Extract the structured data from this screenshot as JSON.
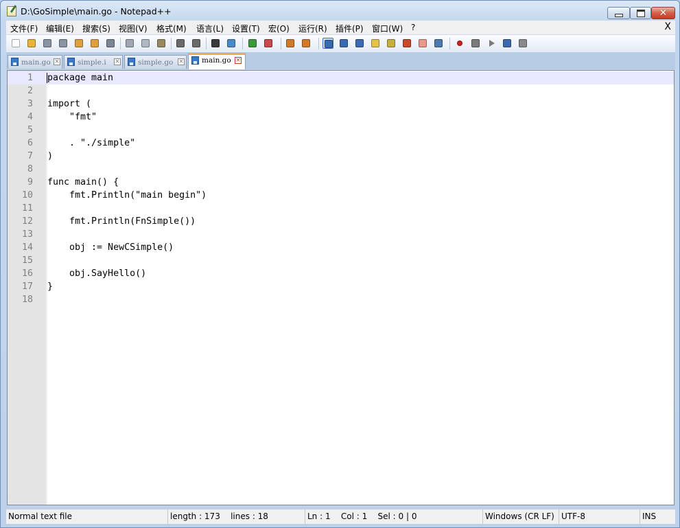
{
  "window": {
    "title": "D:\\GoSimple\\main.go - Notepad++",
    "controls": {
      "minimize": "_",
      "maximize": "□",
      "close": "✕"
    }
  },
  "menu": {
    "items": [
      {
        "label": "文件(F)"
      },
      {
        "label": "编辑(E)"
      },
      {
        "label": "搜索(S)"
      },
      {
        "label": "视图(V)"
      },
      {
        "label": "格式(M)"
      },
      {
        "label": "语言(L)"
      },
      {
        "label": "设置(T)"
      },
      {
        "label": "宏(O)"
      },
      {
        "label": "运行(R)"
      },
      {
        "label": "插件(P)"
      },
      {
        "label": "窗口(W)"
      },
      {
        "label": "?"
      }
    ],
    "close_glyph": "X"
  },
  "toolbar": {
    "buttons": [
      {
        "icon": "new-file-icon",
        "color": "#ffffff"
      },
      {
        "icon": "open-file-icon",
        "color": "#e8b53a"
      },
      {
        "icon": "save-icon",
        "color": "#8a95a3"
      },
      {
        "icon": "save-all-icon",
        "color": "#8a95a3"
      },
      {
        "icon": "close-file-icon",
        "color": "#e0a040"
      },
      {
        "icon": "close-all-icon",
        "color": "#e0a040"
      },
      {
        "icon": "print-icon",
        "color": "#7b8694"
      },
      {
        "icon": "cut-icon",
        "color": "#a0a8b4"
      },
      {
        "icon": "copy-icon",
        "color": "#b0b8c4"
      },
      {
        "icon": "paste-icon",
        "color": "#9a8a60"
      },
      {
        "icon": "undo-icon",
        "color": "#6a6a6a"
      },
      {
        "icon": "redo-icon",
        "color": "#6a6a6a"
      },
      {
        "icon": "find-icon",
        "color": "#3a3a3a"
      },
      {
        "icon": "replace-icon",
        "color": "#4a8ac8"
      },
      {
        "icon": "zoom-in-icon",
        "color": "#3a9a3a"
      },
      {
        "icon": "zoom-out-icon",
        "color": "#c84a4a"
      },
      {
        "icon": "sync-vertical-icon",
        "color": "#d07a2a"
      },
      {
        "icon": "sync-horizontal-icon",
        "color": "#d07a2a"
      },
      {
        "icon": "word-wrap-icon",
        "color": "#3a6ab0"
      },
      {
        "icon": "show-all-chars-icon",
        "color": "#3a6ab0"
      },
      {
        "icon": "indent-guide-icon",
        "color": "#3a6ab0"
      },
      {
        "icon": "lang-define-icon",
        "color": "#e6c24a"
      },
      {
        "icon": "doc-map-icon",
        "color": "#c8b040"
      },
      {
        "icon": "function-list-icon",
        "color": "#c84a2a"
      },
      {
        "icon": "folder-workspace-icon",
        "color": "#e89a8a"
      },
      {
        "icon": "monitoring-icon",
        "color": "#4a7ab0"
      },
      {
        "icon": "record-macro-icon",
        "color": "#d02020"
      },
      {
        "icon": "stop-record-icon",
        "color": "#7a7a7a"
      },
      {
        "icon": "playback-icon",
        "color": "#7a7a7a"
      },
      {
        "icon": "run-macro-multiple-icon",
        "color": "#3a6ab0"
      },
      {
        "icon": "save-macro-icon",
        "color": "#8a8a8a"
      }
    ]
  },
  "tabs": [
    {
      "label": "main.go",
      "active": false
    },
    {
      "label": "simple.i",
      "active": false
    },
    {
      "label": "simple.go",
      "active": false
    },
    {
      "label": "main.go",
      "active": true
    }
  ],
  "editor": {
    "current_line": 1,
    "lines": [
      "package main",
      "",
      "import (",
      "    \"fmt\"",
      "",
      "    . \"./simple\"",
      ")",
      "",
      "func main() {",
      "    fmt.Println(\"main begin\")",
      "",
      "    fmt.Println(FnSimple())",
      "",
      "    obj := NewCSimple()",
      "",
      "    obj.SayHello()",
      "}",
      ""
    ]
  },
  "status": {
    "file_type": "Normal text file",
    "length": "length : 173",
    "lines": "lines : 18",
    "ln": "Ln : 1",
    "col": "Col : 1",
    "sel": "Sel : 0 | 0",
    "eol": "Windows (CR LF)",
    "encoding": "UTF-8",
    "mode": "INS"
  }
}
